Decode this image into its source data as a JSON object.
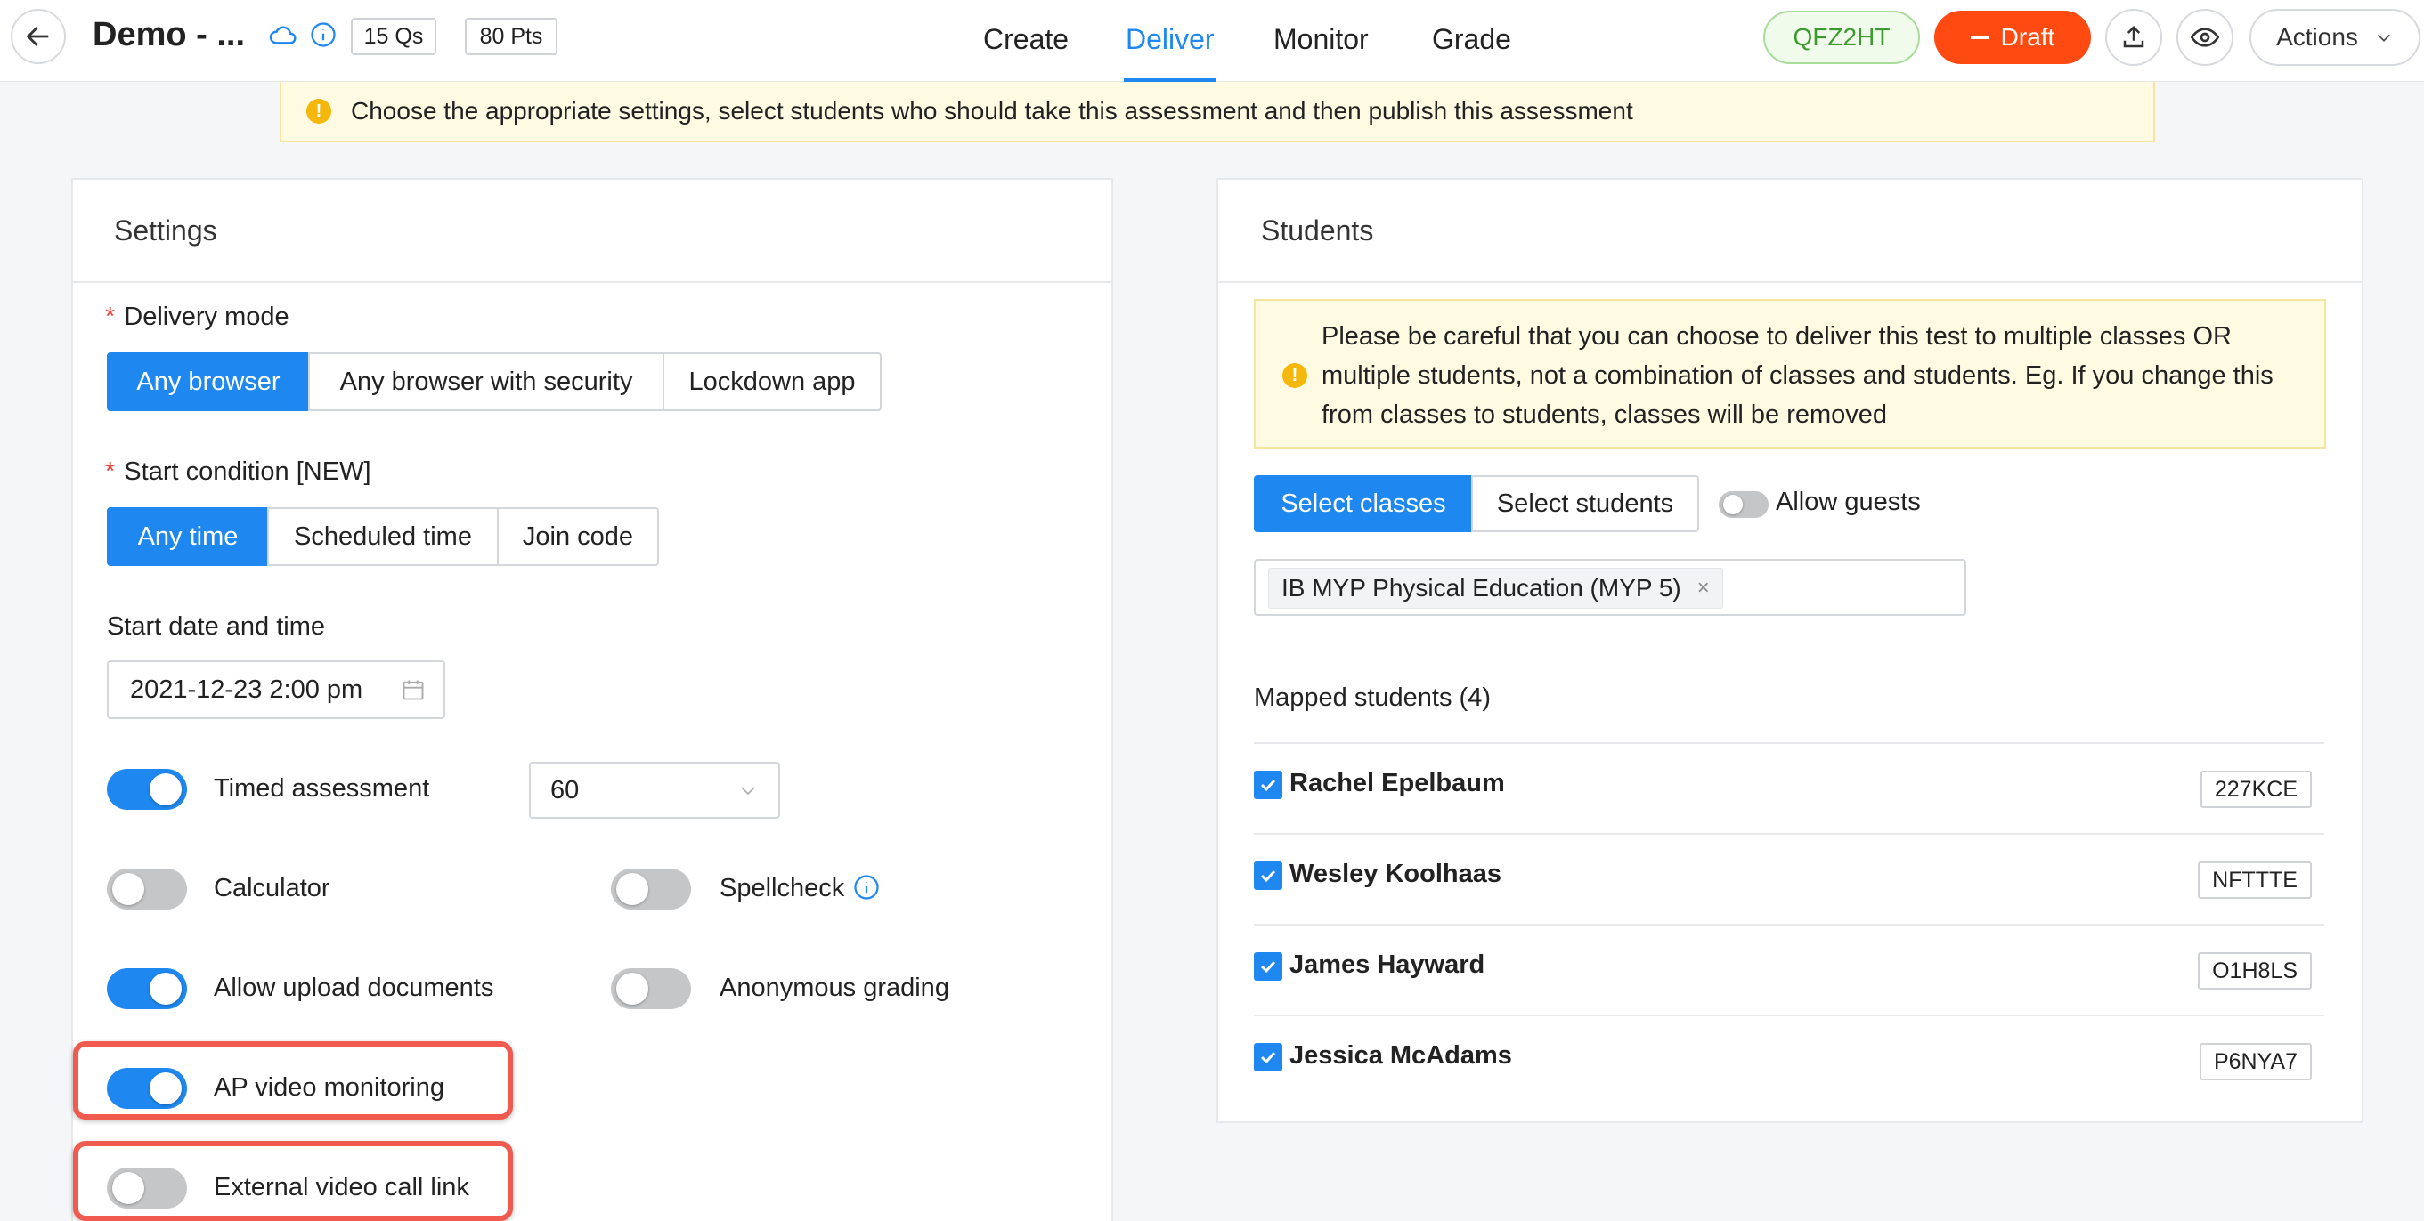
{
  "header": {
    "title": "Demo - ...",
    "questions_chip": "15 Qs",
    "points_chip": "80 Pts",
    "tabs": [
      {
        "label": "Create"
      },
      {
        "label": "Deliver"
      },
      {
        "label": "Monitor"
      },
      {
        "label": "Grade"
      }
    ],
    "active_tab": "Deliver",
    "join_code": "QFZ2HT",
    "draft_label": "Draft",
    "actions_label": "Actions"
  },
  "notice": "Choose the appropriate settings, select students who should take this assessment and then publish this assessment",
  "settings": {
    "title": "Settings",
    "delivery_mode": {
      "label": "Delivery mode",
      "options": [
        "Any browser",
        "Any browser with security",
        "Lockdown app"
      ],
      "selected": "Any browser"
    },
    "start_condition": {
      "label": "Start condition [NEW]",
      "options": [
        "Any time",
        "Scheduled time",
        "Join code"
      ],
      "selected": "Any time"
    },
    "start_date": {
      "label": "Start date and time",
      "value": "2021-12-23 2:00 pm"
    },
    "toggles": {
      "timed": {
        "label": "Timed assessment",
        "on": true
      },
      "calculator": {
        "label": "Calculator",
        "on": false
      },
      "spellcheck": {
        "label": "Spellcheck",
        "on": false
      },
      "upload": {
        "label": "Allow upload documents",
        "on": true
      },
      "anonymous": {
        "label": "Anonymous grading",
        "on": false
      },
      "ap_video": {
        "label": "AP video monitoring",
        "on": true
      },
      "external_call": {
        "label": "External video call link",
        "on": false
      }
    },
    "time_limit": "60"
  },
  "students": {
    "title": "Students",
    "alert": "Please be careful that you can choose to deliver this test to multiple classes OR multiple students, not a combination of classes and students. Eg. If you change this from classes to students, classes will be removed",
    "select_options": [
      "Select classes",
      "Select students"
    ],
    "selected_option": "Select classes",
    "allow_guests": {
      "label": "Allow guests",
      "on": false
    },
    "class_tag": "IB MYP Physical Education (MYP 5)",
    "mapped_title": "Mapped students (4)",
    "list": [
      {
        "name": "Rachel Epelbaum",
        "code": "227KCE",
        "checked": true
      },
      {
        "name": "Wesley Koolhaas",
        "code": "NFTTTE",
        "checked": true
      },
      {
        "name": "James Hayward",
        "code": "O1H8LS",
        "checked": true
      },
      {
        "name": "Jessica McAdams",
        "code": "P6NYA7",
        "checked": true
      }
    ]
  },
  "colors": {
    "accent": "#1e88f0",
    "draft": "#ff4a12",
    "code_green": "#3c9a2e",
    "highlight": "#f05a4f",
    "warning": "#f5b70c"
  }
}
